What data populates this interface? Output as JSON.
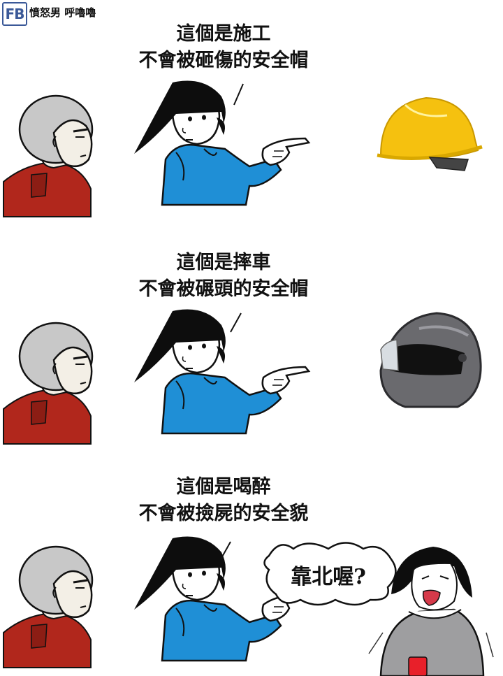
{
  "header": {
    "logo_text": "FB",
    "brand_title": "憤怒男 呼嚕嚕"
  },
  "panels": [
    {
      "caption_line1": "這個是施工",
      "caption_line2": "不會被砸傷的安全帽",
      "object": "hard-hat"
    },
    {
      "caption_line1": "這個是摔車",
      "caption_line2": "不會被碾頭的安全帽",
      "object": "motorcycle-helmet"
    },
    {
      "caption_line1": "這個是喝醉",
      "caption_line2": "不會被撿屍的安全貌",
      "object": "woman-speaking"
    }
  ],
  "speech_bubble": {
    "text": "靠北喔?"
  },
  "colors": {
    "shirt_blue": "#1f8fd6",
    "jacket_red": "#b1271c",
    "hard_hat_yellow": "#f5c10f",
    "helmet_grey": "#6a6a6e",
    "hair_black": "#0d0d0d",
    "bald_grey": "#c8c8c8"
  }
}
